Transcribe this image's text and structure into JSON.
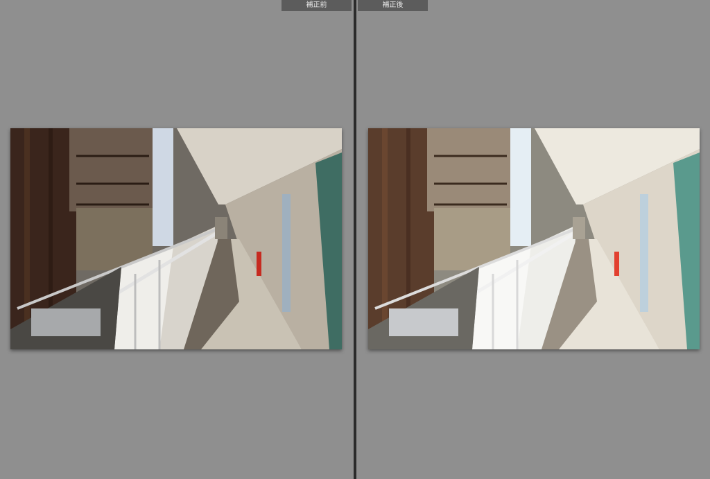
{
  "compare": {
    "before_label": "補正前",
    "after_label": "補正後"
  },
  "colors": {
    "background": "#8f8f8f",
    "divider": "#2b2b2b",
    "label_background": "#5c5c5c",
    "label_text": "#e6e6e6"
  },
  "photo": {
    "subject": "apartment-corridor"
  }
}
